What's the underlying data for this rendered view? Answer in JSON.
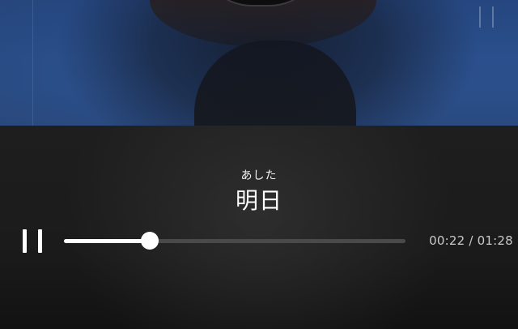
{
  "lyrics": {
    "ruby": "あした",
    "text": "明日"
  },
  "controls": {
    "play_state_icon": "pause-icon"
  },
  "playback": {
    "current_time": "00:22",
    "separator": "/",
    "total_time": "01:28",
    "progress_fraction": 0.25
  },
  "colors": {
    "accent": "#ffffff",
    "track": "#4a4a4c",
    "panel_bg": "#1b1b1b",
    "time_text": "#c9c9c9"
  }
}
